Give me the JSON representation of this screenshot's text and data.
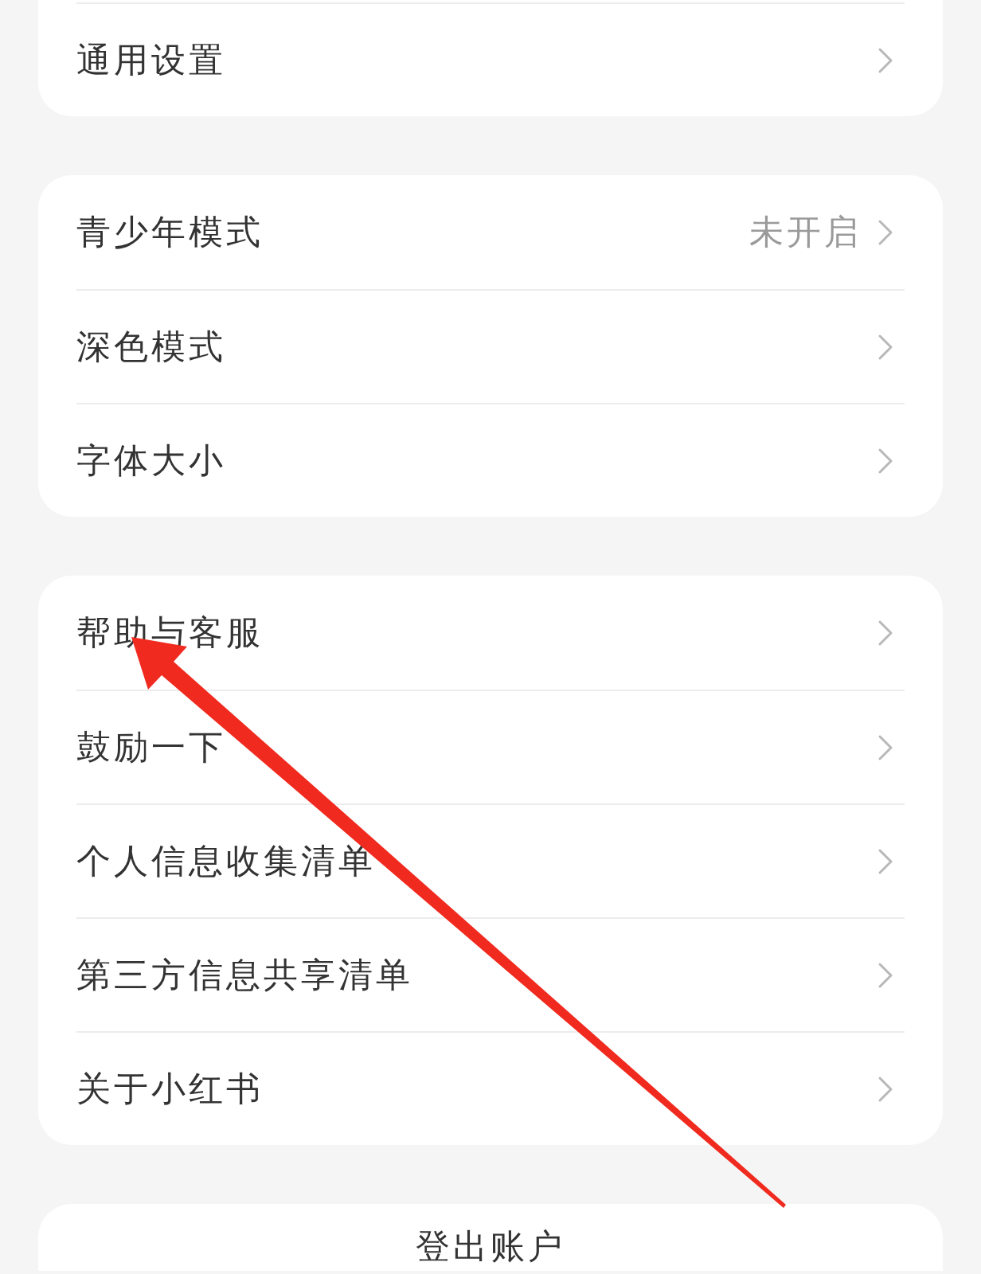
{
  "groups": [
    {
      "items": [
        {
          "label": "通用设置"
        }
      ],
      "cut_top": true
    },
    {
      "items": [
        {
          "label": "青少年模式",
          "value": "未开启"
        },
        {
          "label": "深色模式"
        },
        {
          "label": "字体大小"
        }
      ]
    },
    {
      "items": [
        {
          "label": "帮助与客服"
        },
        {
          "label": "鼓励一下"
        },
        {
          "label": "个人信息收集清单"
        },
        {
          "label": "第三方信息共享清单"
        },
        {
          "label": "关于小红书"
        }
      ]
    }
  ],
  "logout": {
    "label": "登出账户"
  }
}
